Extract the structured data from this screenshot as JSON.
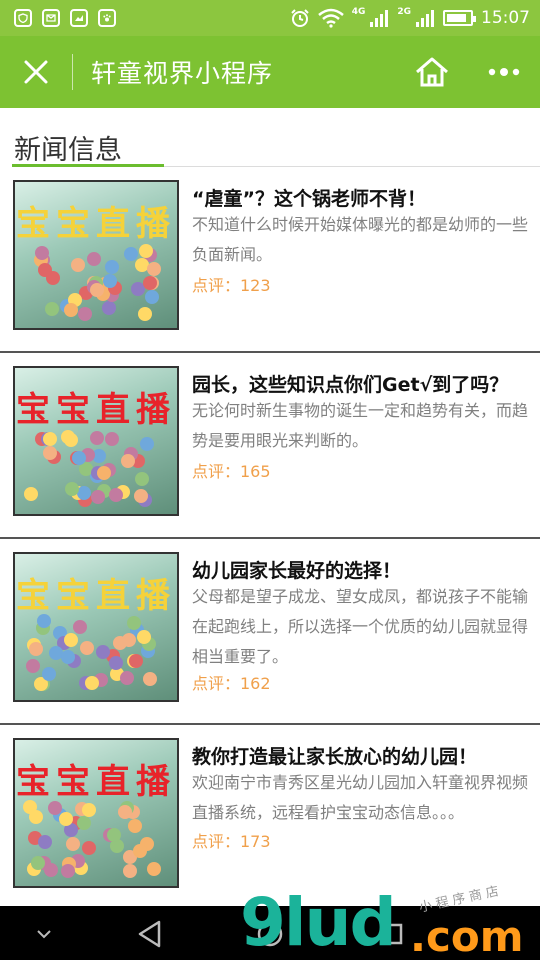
{
  "status_bar": {
    "icons": [
      "shield-icon",
      "mail-icon",
      "gallery-icon",
      "paw-icon",
      "alarm-icon",
      "wifi-icon",
      "signal-icon",
      "signal-icon",
      "battery-icon"
    ],
    "network_1": "4G",
    "network_2": "2G",
    "battery_level": 0.85,
    "time": "15:07"
  },
  "title_bar": {
    "close_icon": "close-icon",
    "title": "轩童视界小程序",
    "home_icon": "home-icon",
    "more_icon": "more-icon"
  },
  "section": {
    "title": "新闻信息"
  },
  "news": [
    {
      "thumb_tag": "宝宝直播",
      "title": "“虐童”？这个锅老师不背！",
      "desc": "不知道什么时候开始媒体曝光的都是幼师的一些负面新闻。",
      "comment": "点评：123"
    },
    {
      "thumb_tag": "宝宝直播",
      "title": "园长，这些知识点你们Get√到了吗？",
      "desc": "无论何时新生事物的诞生一定和趋势有关，而趋势是要用眼光来判断的。",
      "comment": "点评：165"
    },
    {
      "thumb_tag": "宝宝直播",
      "title": "幼儿园家长最好的选择！",
      "desc": "父母都是望子成龙、望女成凤，都说孩子不能输在起跑线上，所以选择一个优质的幼儿园就显得相当重要了。",
      "comment": "点评：162"
    },
    {
      "thumb_tag": "宝宝直播",
      "title": "教你打造最让家长放心的幼儿园！",
      "desc": "欢迎南宁市青秀区星光幼儿园加入轩童视界视频直播系统，远程看护宝宝动态信息。。。",
      "comment": "点评：173"
    }
  ],
  "nav_bar": {
    "icons": [
      "chevron-down-icon",
      "back-icon",
      "home-circle-icon",
      "recent-apps-icon"
    ]
  },
  "watermark": {
    "main": "9lud",
    "com": ".com",
    "sub": "小程序商店"
  },
  "colors": {
    "header_green": "#7dc232",
    "status_green": "#8cc63f",
    "accent_orange": "#f0a04b",
    "title_underline": "#6bbd2e"
  }
}
